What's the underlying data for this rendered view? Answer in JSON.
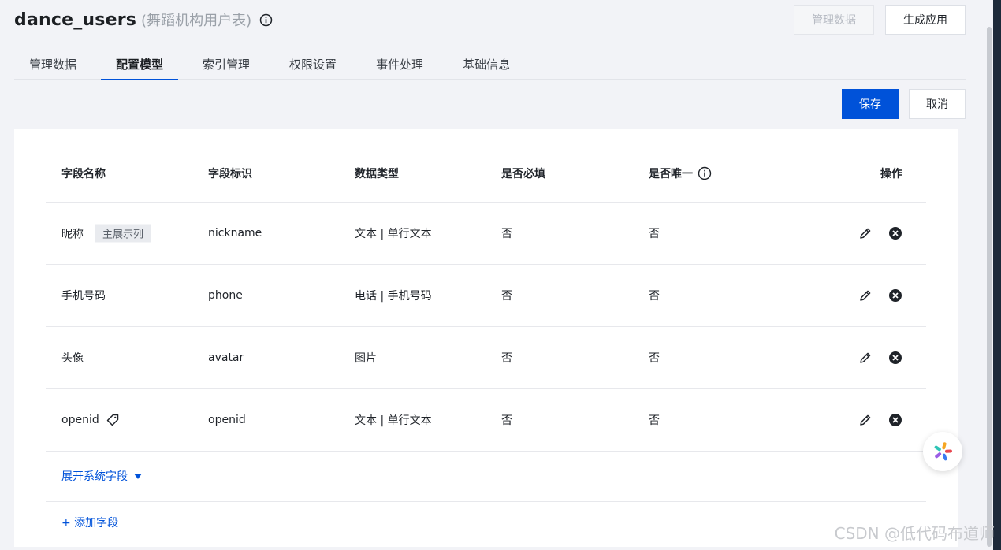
{
  "header": {
    "title": "dance_users",
    "subtitle": "(舞蹈机构用户表)",
    "manage_data_button": "管理数据",
    "generate_app_button": "生成应用"
  },
  "tabs": [
    {
      "label": "管理数据",
      "active": false
    },
    {
      "label": "配置模型",
      "active": true
    },
    {
      "label": "索引管理",
      "active": false
    },
    {
      "label": "权限设置",
      "active": false
    },
    {
      "label": "事件处理",
      "active": false
    },
    {
      "label": "基础信息",
      "active": false
    }
  ],
  "actions": {
    "save": "保存",
    "cancel": "取消"
  },
  "table": {
    "columns": [
      "字段名称",
      "字段标识",
      "数据类型",
      "是否必填",
      "是否唯一",
      "操作"
    ],
    "rows": [
      {
        "name": "昵称",
        "tag": "主展示列",
        "key": "nickname",
        "type": "文本 | 单行文本",
        "required": "否",
        "unique": "否"
      },
      {
        "name": "手机号码",
        "tag": "",
        "key": "phone",
        "type": "电话 | 手机号码",
        "required": "否",
        "unique": "否"
      },
      {
        "name": "头像",
        "tag": "",
        "key": "avatar",
        "type": "图片",
        "required": "否",
        "unique": "否"
      },
      {
        "name": "openid",
        "tag": "",
        "key": "openid",
        "type": "文本 | 单行文本",
        "required": "否",
        "unique": "否"
      }
    ]
  },
  "expand_system_fields": "展开系统字段",
  "add_field": "+ 添加字段",
  "watermark": "CSDN @低代码布道师",
  "colors": {
    "primary": "#0052d9",
    "background": "#f2f3f7"
  }
}
